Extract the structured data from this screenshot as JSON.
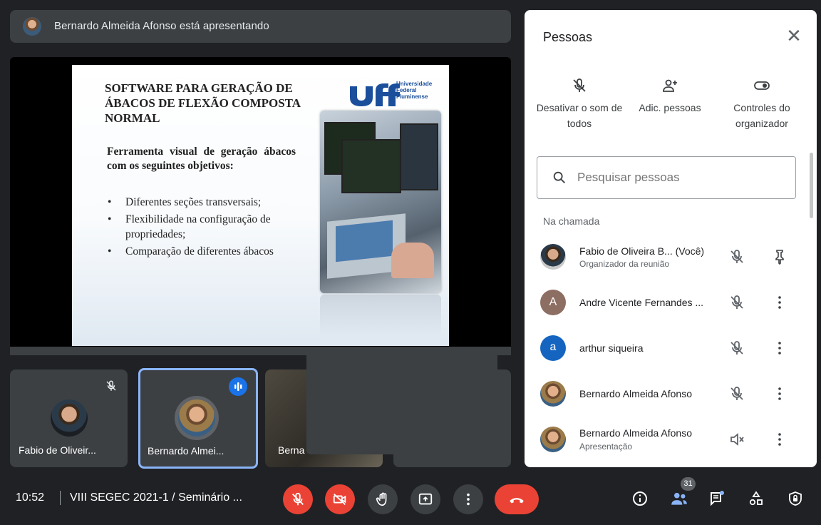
{
  "presenter_bar": {
    "text": "Bernardo Almeida Afonso está apresentando"
  },
  "slide": {
    "title": "SOFTWARE PARA GERAÇÃO DE ÁBACOS DE FLEXÃO COMPOSTA NORMAL",
    "subtitle": "Ferramenta visual de geração ábacos com os seguintes objetivos:",
    "bullets": [
      "Diferentes seções transversais;",
      "Flexibilidade na configuração de propriedades;",
      "Comparação de diferentes ábacos"
    ],
    "logo_text": "Universidade Federal Fluminense"
  },
  "tiles": [
    {
      "name": "Fabio de Oliveir..."
    },
    {
      "name": "Bernardo Almei..."
    },
    {
      "name": "Berna"
    }
  ],
  "panel": {
    "title": "Pessoas",
    "actions": [
      {
        "label": "Desativar o som de todos",
        "icon": "mic-off-icon"
      },
      {
        "label": "Adic. pessoas",
        "icon": "add-person-icon"
      },
      {
        "label": "Controles do organizador",
        "icon": "toggle-icon"
      }
    ],
    "search_placeholder": "Pesquisar pessoas",
    "section_label": "Na chamada",
    "people": [
      {
        "name": "Fabio de Oliveira B...  (Você)",
        "sub": "Organizador da reunião",
        "avatar": "photo",
        "action": "pin-icon"
      },
      {
        "name": "Andre Vicente Fernandes ...",
        "sub": "",
        "avatar": "A",
        "avatar_color": "#8d6e63",
        "action": "more-icon"
      },
      {
        "name": "arthur siqueira",
        "sub": "",
        "avatar": "a",
        "avatar_color": "#1565c0",
        "action": "more-icon"
      },
      {
        "name": "Bernardo Almeida Afonso",
        "sub": "",
        "avatar": "photo",
        "action": "more-icon"
      },
      {
        "name": "Bernardo Almeida Afonso",
        "sub": "Apresentação",
        "avatar": "photo",
        "action": "more-icon"
      }
    ]
  },
  "bottom_bar": {
    "time": "10:52",
    "meeting_title": "VIII SEGEC 2021-1 / Seminário ...",
    "participants_count": "31",
    "end_call_color": "#ea4335",
    "muted_color": "#ea4335"
  }
}
